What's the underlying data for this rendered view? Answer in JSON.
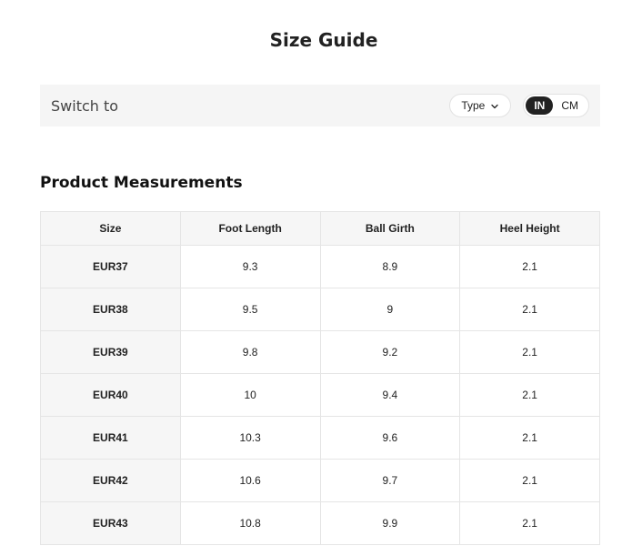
{
  "page": {
    "title": "Size Guide"
  },
  "switch_bar": {
    "label": "Switch to",
    "type_select": {
      "label": "Type",
      "icon": "chevron-down-icon"
    },
    "units": [
      {
        "label": "IN",
        "active": true
      },
      {
        "label": "CM",
        "active": false
      }
    ]
  },
  "measurements": {
    "title": "Product Measurements",
    "columns": [
      "Size",
      "Foot Length",
      "Ball Girth",
      "Heel Height"
    ],
    "rows": [
      [
        "EUR37",
        "9.3",
        "8.9",
        "2.1"
      ],
      [
        "EUR38",
        "9.5",
        "9",
        "2.1"
      ],
      [
        "EUR39",
        "9.8",
        "9.2",
        "2.1"
      ],
      [
        "EUR40",
        "10",
        "9.4",
        "2.1"
      ],
      [
        "EUR41",
        "10.3",
        "9.6",
        "2.1"
      ],
      [
        "EUR42",
        "10.6",
        "9.7",
        "2.1"
      ],
      [
        "EUR43",
        "10.8",
        "9.9",
        "2.1"
      ]
    ]
  },
  "colors": {
    "bar_background": "#f5f5f5",
    "active_unit_bg": "#222222",
    "header_bg": "#f6f6f6",
    "border": "#e5e5e5"
  }
}
